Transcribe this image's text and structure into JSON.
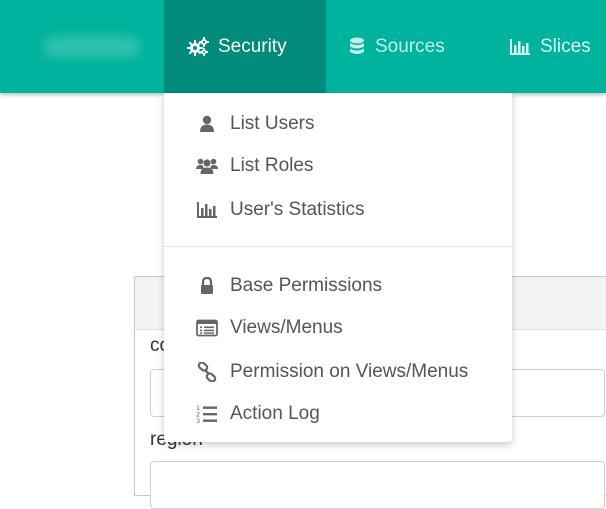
{
  "navbar": {
    "items": [
      {
        "label": "Security",
        "icon": "gears-icon"
      },
      {
        "label": "Sources",
        "icon": "database-icon"
      },
      {
        "label": "Slices",
        "icon": "bar-chart-icon"
      }
    ]
  },
  "security_menu": {
    "items": [
      {
        "label": "List Users",
        "icon": "user-icon"
      },
      {
        "label": "List Roles",
        "icon": "group-icon"
      },
      {
        "label": "User's Statistics",
        "icon": "bar-chart-icon"
      },
      {
        "label": "Base Permissions",
        "icon": "lock-icon"
      },
      {
        "label": "Views/Menus",
        "icon": "list-window-icon"
      },
      {
        "label": "Permission on Views/Menus",
        "icon": "link-icon"
      },
      {
        "label": "Action Log",
        "icon": "ordered-list-icon"
      }
    ]
  },
  "form": {
    "field1_label": "co",
    "field2_label": "region"
  },
  "colors": {
    "navbar": "#00b39e",
    "navbar_active": "#008b7b",
    "menu_text": "#555555"
  }
}
